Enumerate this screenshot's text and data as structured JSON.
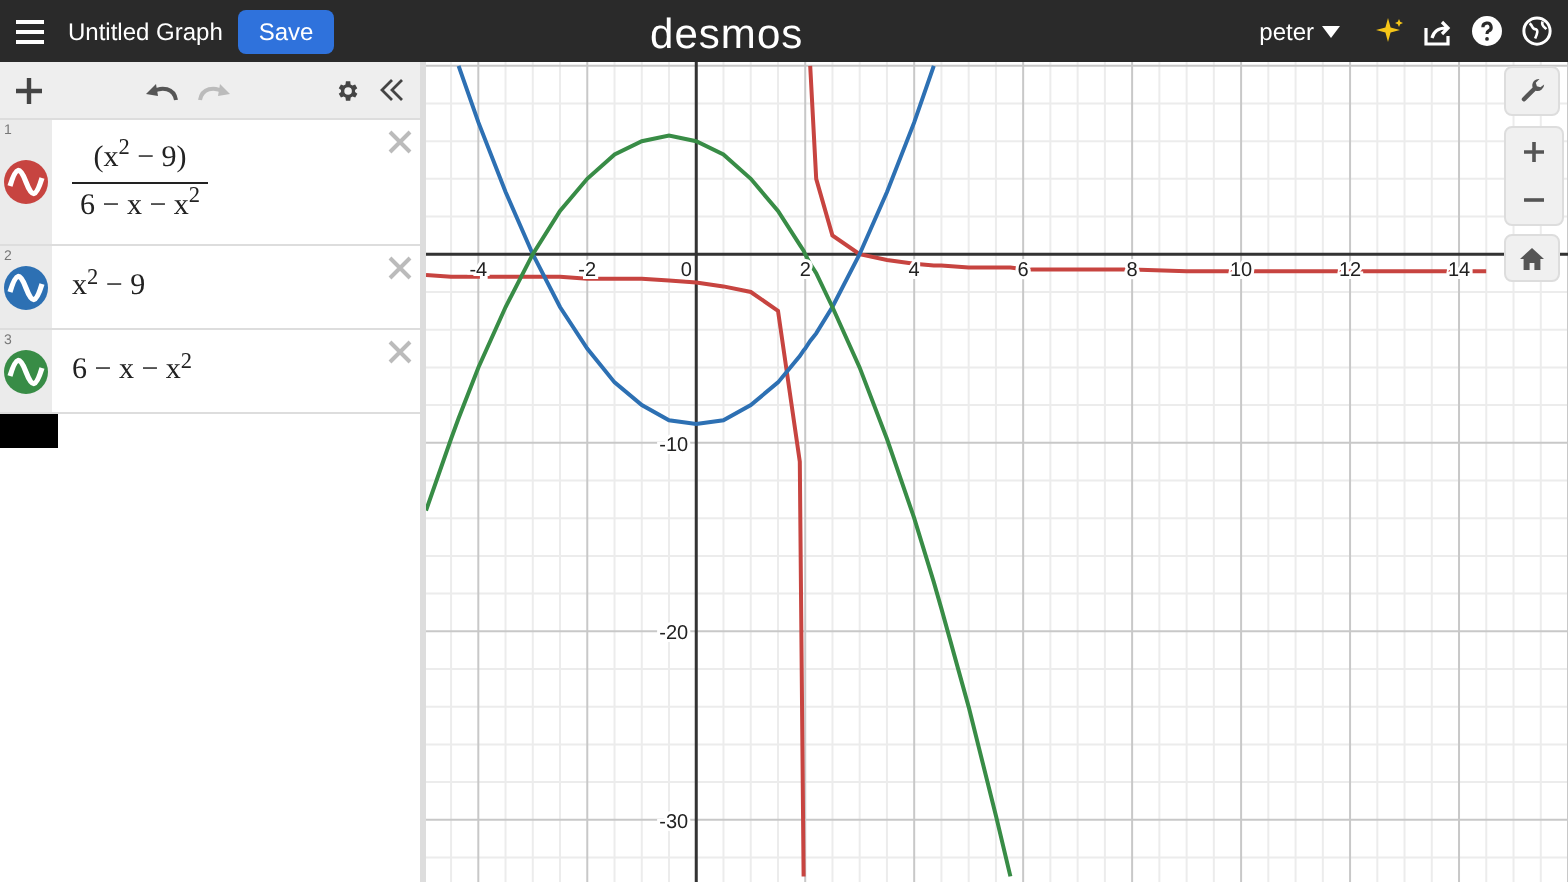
{
  "top_bar": {
    "title": "Untitled Graph",
    "save": "Save",
    "logo": "desmos",
    "user": "peter"
  },
  "expressions": [
    {
      "number": "1",
      "color": "#c74440",
      "kind": "fraction",
      "numerator": "(x$^{2}$ − 9)",
      "denominator": "6 − x − x$^{2}$"
    },
    {
      "number": "2",
      "color": "#2d70b3",
      "kind": "plain",
      "text": "x$^{2}$ − 9"
    },
    {
      "number": "3",
      "color": "#388c46",
      "kind": "plain",
      "text": "6 − x − x$^{2}$"
    }
  ],
  "graph": {
    "chart_data": {
      "type": "line",
      "grid": true,
      "xlim": [
        -4.96,
        16.0
      ],
      "ylim": [
        -33.3,
        10.2
      ],
      "xticks": [
        -4,
        -2,
        0,
        2,
        4,
        6,
        8,
        10,
        12,
        14
      ],
      "yticks": [
        -30,
        -20,
        -10
      ],
      "x": [
        -4.96,
        -4.5,
        -4.36,
        -4,
        -3.5,
        -3,
        -2.5,
        -2,
        -1.5,
        -1,
        -0.5,
        0,
        0.5,
        1,
        1.5,
        1.9,
        1.969,
        2,
        2.091,
        2.2,
        2.5,
        3,
        3.5,
        4,
        4.36,
        4.5,
        5,
        5.5,
        5.765,
        6,
        7,
        8,
        9,
        10,
        11,
        12,
        13,
        14,
        14.5
      ],
      "series": [
        {
          "color": "#c74440",
          "values": [
            -1.1,
            -1.2,
            -1.2,
            -1.2,
            -1.2,
            -1.2,
            -1.2,
            -1.3,
            -1.3,
            -1.3,
            -1.4,
            -1.5,
            -1.7,
            -2,
            -3,
            -11,
            -33,
            null,
            10,
            4,
            1,
            0,
            -0.3,
            -0.5,
            -0.6,
            -0.6,
            -0.7,
            -0.7,
            -0.7,
            -0.8,
            -0.8,
            -0.8,
            -0.9,
            -0.9,
            -0.9,
            -0.9,
            -0.9,
            -0.9,
            -0.9
          ]
        },
        {
          "color": "#2d70b3",
          "values": [
            null,
            null,
            10,
            7,
            3.3,
            0,
            -2.8,
            -5,
            -6.8,
            -8,
            -8.8,
            -9,
            -8.8,
            -8,
            -6.8,
            -5.4,
            -5.1,
            -5,
            -4.6,
            -4.2,
            -2.8,
            0,
            3.3,
            7,
            10,
            null,
            null,
            null,
            null,
            null,
            null,
            null,
            null,
            null,
            null,
            null,
            null,
            null,
            null
          ]
        },
        {
          "color": "#388c46",
          "values": [
            -13.6,
            -9.8,
            -8.7,
            -6,
            -2.8,
            0,
            2.3,
            4,
            5.3,
            6,
            6.3,
            6,
            5.3,
            4,
            2.3,
            0.5,
            0.2,
            0,
            -0.5,
            -1,
            -2.8,
            -6,
            -9.8,
            -14,
            -17.4,
            -18.8,
            -24,
            -29.8,
            -33,
            null,
            null,
            null,
            null,
            null,
            null,
            null,
            null,
            null,
            null
          ]
        }
      ]
    }
  }
}
